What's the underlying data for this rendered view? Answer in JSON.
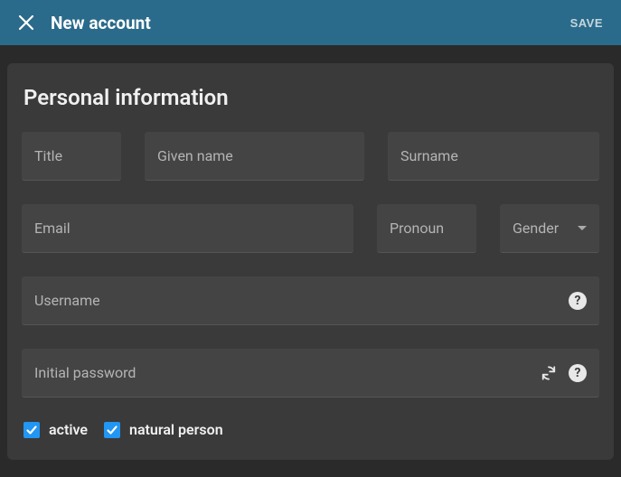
{
  "header": {
    "title": "New account",
    "save_label": "SAVE"
  },
  "section": {
    "title": "Personal information"
  },
  "fields": {
    "title": "Title",
    "given_name": "Given name",
    "surname": "Surname",
    "email": "Email",
    "pronoun": "Pronoun",
    "gender": "Gender",
    "username": "Username",
    "initial_password": "Initial password"
  },
  "checkboxes": {
    "active": {
      "label": "active",
      "checked": true
    },
    "natural_person": {
      "label": "natural person",
      "checked": true
    }
  }
}
